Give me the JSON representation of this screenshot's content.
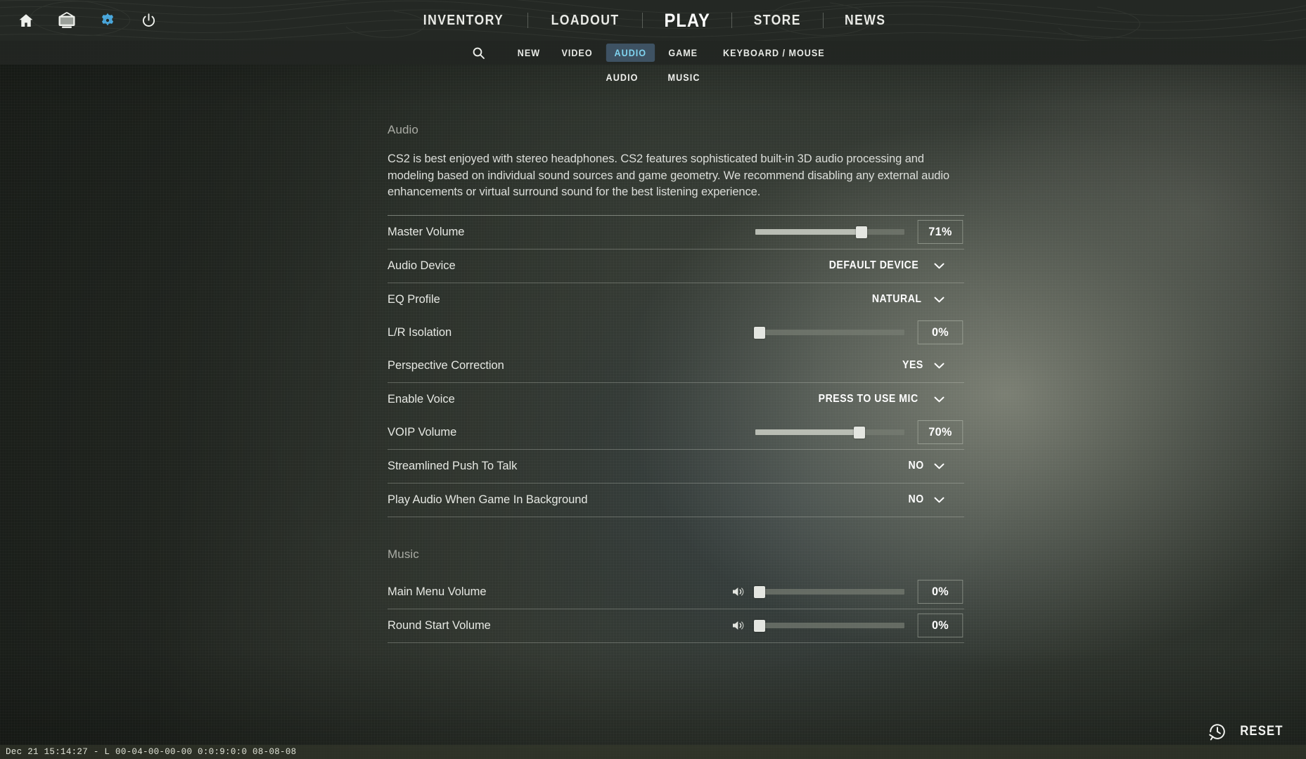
{
  "header": {
    "icons": [
      {
        "name": "home-icon",
        "label": "Home"
      },
      {
        "name": "watch-icon",
        "label": "Watch"
      },
      {
        "name": "settings-gear-icon",
        "label": "Settings"
      },
      {
        "name": "power-icon",
        "label": "Quit"
      }
    ],
    "nav": [
      {
        "label": "INVENTORY",
        "active": false
      },
      {
        "label": "LOADOUT",
        "active": false
      },
      {
        "label": "PLAY",
        "active": true
      },
      {
        "label": "STORE",
        "active": false
      },
      {
        "label": "NEWS",
        "active": false
      }
    ]
  },
  "tabbar": {
    "search_icon": "search-icon",
    "tabs": [
      {
        "label": "NEW",
        "active": false
      },
      {
        "label": "VIDEO",
        "active": false
      },
      {
        "label": "AUDIO",
        "active": true
      },
      {
        "label": "GAME",
        "active": false
      },
      {
        "label": "KEYBOARD / MOUSE",
        "active": false
      }
    ]
  },
  "subtabs": [
    {
      "label": "AUDIO"
    },
    {
      "label": "MUSIC"
    }
  ],
  "audio_section": {
    "title": "Audio",
    "description": "CS2 is best enjoyed with stereo headphones. CS2 features sophisticated built-in 3D audio processing and modeling based on individual sound sources and game geometry. We recommend disabling any external audio enhancements or virtual surround sound for the best listening experience.",
    "rows": [
      {
        "label": "Master Volume",
        "type": "slider",
        "value": "71%",
        "percent": 71
      },
      {
        "label": "Audio Device",
        "type": "dropdown",
        "value": "DEFAULT DEVICE"
      },
      {
        "label": "EQ Profile",
        "type": "dropdown",
        "value": "NATURAL"
      },
      {
        "label": "L/R Isolation",
        "type": "slider",
        "value": "0%",
        "percent": 0
      },
      {
        "label": "Perspective Correction",
        "type": "dropdown",
        "value": "YES"
      },
      {
        "label": "Enable Voice",
        "type": "dropdown",
        "value": "PRESS TO USE MIC"
      },
      {
        "label": "VOIP Volume",
        "type": "slider",
        "value": "70%",
        "percent": 70
      },
      {
        "label": "Streamlined Push To Talk",
        "type": "dropdown",
        "value": "NO"
      },
      {
        "label": "Play Audio When Game In Background",
        "type": "dropdown",
        "value": "NO"
      }
    ]
  },
  "music_section": {
    "title": "Music",
    "rows": [
      {
        "label": "Main Menu Volume",
        "type": "slider",
        "value": "0%",
        "percent": 0,
        "icon": "speaker-icon"
      },
      {
        "label": "Round Start Volume",
        "type": "slider",
        "value": "0%",
        "percent": 0,
        "icon": "speaker-icon"
      }
    ]
  },
  "reset": {
    "label": "RESET",
    "icon": "history-reset-icon"
  },
  "statusbar": {
    "text": "Dec 21 15:14:27 - L 00-04-00-00-00 0:0:9:0:0 08-08-08"
  },
  "colors": {
    "accent_tab_bg": "#3e5263",
    "accent_tab_text": "#7fd3ef",
    "gear_icon": "#4aa8dd",
    "background": "#2b302a"
  }
}
